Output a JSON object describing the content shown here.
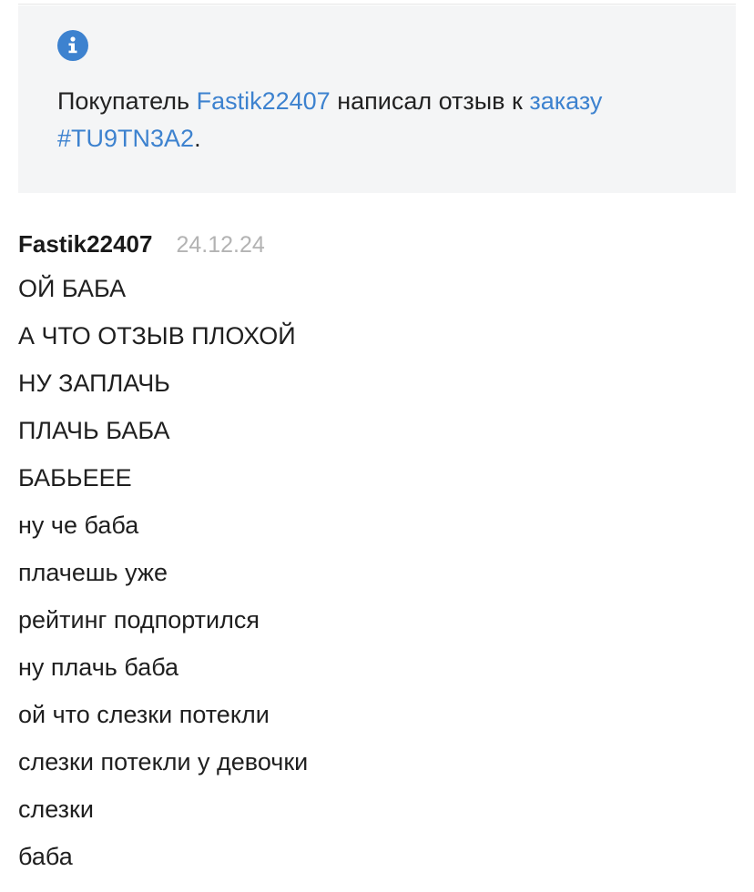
{
  "notice": {
    "icon": "info-icon",
    "accent_color": "#3d82cf",
    "prefix": "Покупатель ",
    "buyer_name": "Fastik22407",
    "middle": " написал отзыв к ",
    "order_link_text": "заказу",
    "order_id": "#TU9TN3A2",
    "suffix": "."
  },
  "review": {
    "author": "Fastik22407",
    "date": "24.12.24",
    "lines": [
      "ОЙ БАБА",
      "А ЧТО ОТЗЫВ ПЛОХОЙ",
      "НУ ЗАПЛАЧЬ",
      "ПЛАЧЬ БАБА",
      "БАБЬЕЕЕ",
      "ну че баба",
      "плачешь уже",
      "рейтинг подпортился",
      "ну плачь баба",
      "ой что слезки потекли",
      "слезки потекли у девочки",
      "слезки",
      "баба"
    ]
  }
}
